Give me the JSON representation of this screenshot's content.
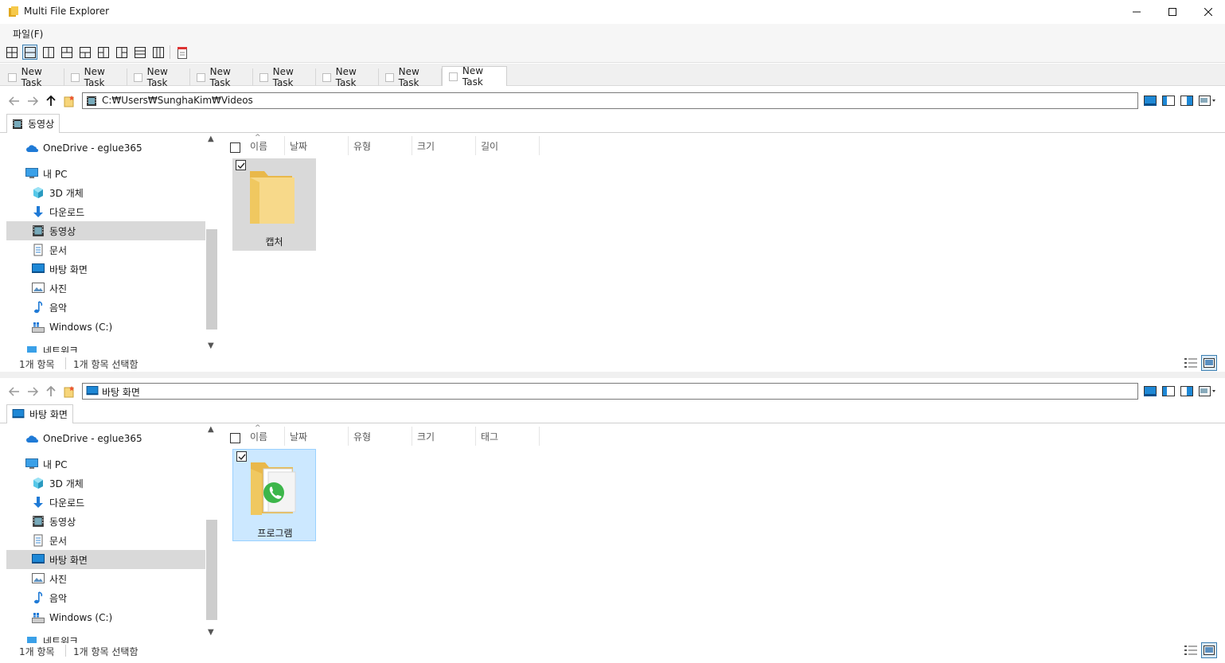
{
  "window": {
    "title": "Multi File Explorer"
  },
  "menu": {
    "file": "파일(F)"
  },
  "tasks": [
    {
      "label": "New Task"
    },
    {
      "label": "New Task"
    },
    {
      "label": "New Task"
    },
    {
      "label": "New Task"
    },
    {
      "label": "New Task"
    },
    {
      "label": "New Task"
    },
    {
      "label": "New Task"
    },
    {
      "label": "New Task"
    }
  ],
  "columns_common": {
    "name": "이름",
    "date": "날짜",
    "type": "유형",
    "size": "크기"
  },
  "tree_labels": {
    "onedrive": "OneDrive - eglue365",
    "mypc": "내 PC",
    "objects3d": "3D 개체",
    "downloads": "다운로드",
    "videos": "동영상",
    "documents": "문서",
    "desktop": "바탕 화면",
    "pictures": "사진",
    "music": "음악",
    "windows": "Windows  (C:)",
    "network": "네트워크"
  },
  "pane1": {
    "address": "C:₩Users₩SunghaKim₩Videos",
    "tab": "동영상",
    "extra_column": "길이",
    "item": {
      "name": "캡처"
    },
    "status": {
      "count": "1개 항목",
      "selected": "1개 항목 선택함"
    }
  },
  "pane2": {
    "address": "바탕 화면",
    "tab": "바탕 화면",
    "extra_column": "태그",
    "item": {
      "name": "프로그램"
    },
    "status": {
      "count": "1개 항목",
      "selected": "1개 항목 선택함"
    }
  },
  "colors": {
    "accent": "#3c7fb1",
    "selection": "#cce8ff",
    "folder": "#f7d57a"
  }
}
